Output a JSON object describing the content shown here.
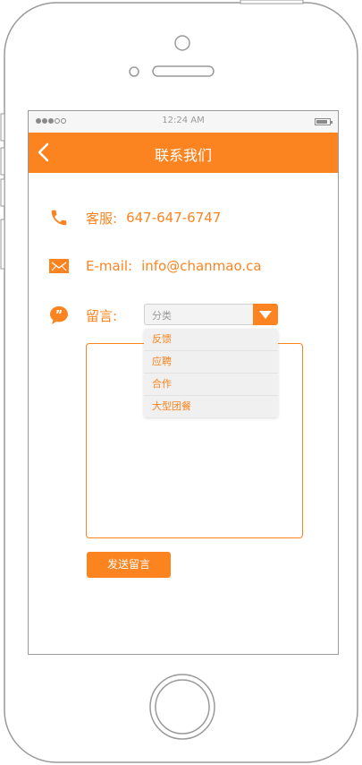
{
  "status_bar": {
    "time": "12:24 AM"
  },
  "header": {
    "title": "联系我们"
  },
  "contact": {
    "phone": {
      "label": "客服:",
      "value": "647-647-6747"
    },
    "email": {
      "label": "E-mail:",
      "value": "info@chanmao.ca"
    }
  },
  "message": {
    "label": "留言:",
    "category_placeholder": "分类",
    "category_options": [
      "反馈",
      "应聘",
      "合作",
      "大型团餐"
    ],
    "send_label": "发送留言"
  },
  "colors": {
    "accent": "#fb8420",
    "frame": "#9a9a9a"
  }
}
